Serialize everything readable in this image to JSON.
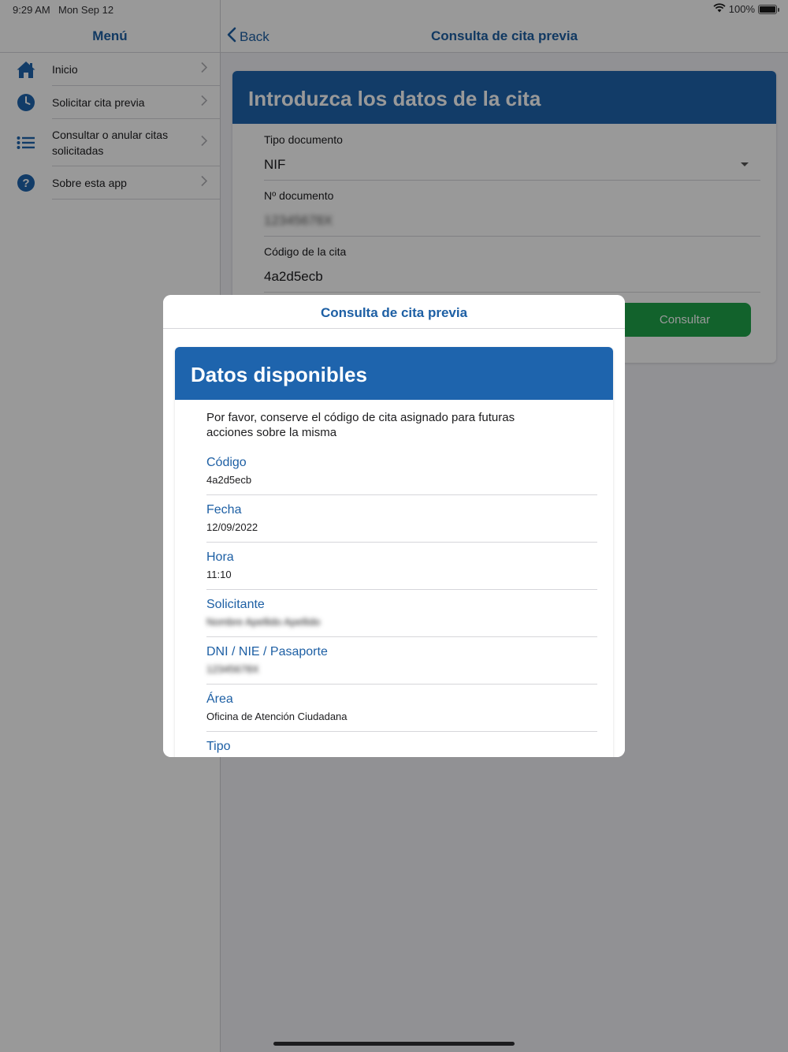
{
  "status_bar": {
    "time": "9:29 AM",
    "date": "Mon Sep 12",
    "battery": "100%"
  },
  "sidebar": {
    "title": "Menú",
    "items": [
      {
        "icon": "home-icon",
        "label": "Inicio"
      },
      {
        "icon": "clock-icon",
        "label": "Solicitar cita previa"
      },
      {
        "icon": "list-icon",
        "label": "Consultar o anular citas solicitadas"
      },
      {
        "icon": "help-icon",
        "label": "Sobre esta app"
      }
    ]
  },
  "main": {
    "back_label": "Back",
    "nav_title": "Consulta de cita previa",
    "form": {
      "title": "Introduzca los datos de la cita",
      "fields": [
        {
          "label": "Tipo documento",
          "value": "NIF"
        },
        {
          "label": "Nº documento",
          "value": "12345678X"
        },
        {
          "label": "Código de la cita",
          "value": "4a2d5ecb"
        }
      ],
      "submit_label": "Consultar"
    }
  },
  "modal": {
    "title": "Consulta de cita previa",
    "card_title": "Datos disponibles",
    "intro": "Por favor, conserve el código de cita asignado para futuras acciones sobre la misma",
    "rows": [
      {
        "label": "Código",
        "value": "4a2d5ecb"
      },
      {
        "label": "Fecha",
        "value": "12/09/2022"
      },
      {
        "label": "Hora",
        "value": "11:10"
      },
      {
        "label": "Solicitante",
        "value": "Nombre Apellido Apellido"
      },
      {
        "label": "DNI / NIE / Pasaporte",
        "value": "12345678X"
      },
      {
        "label": "Área",
        "value": "Oficina de Atención Ciudadana"
      },
      {
        "label": "Tipo",
        "value": ""
      }
    ]
  },
  "colors": {
    "brand_blue": "#1e64ad",
    "link_blue": "#1d5fa4",
    "button_green": "#1ea34a"
  }
}
